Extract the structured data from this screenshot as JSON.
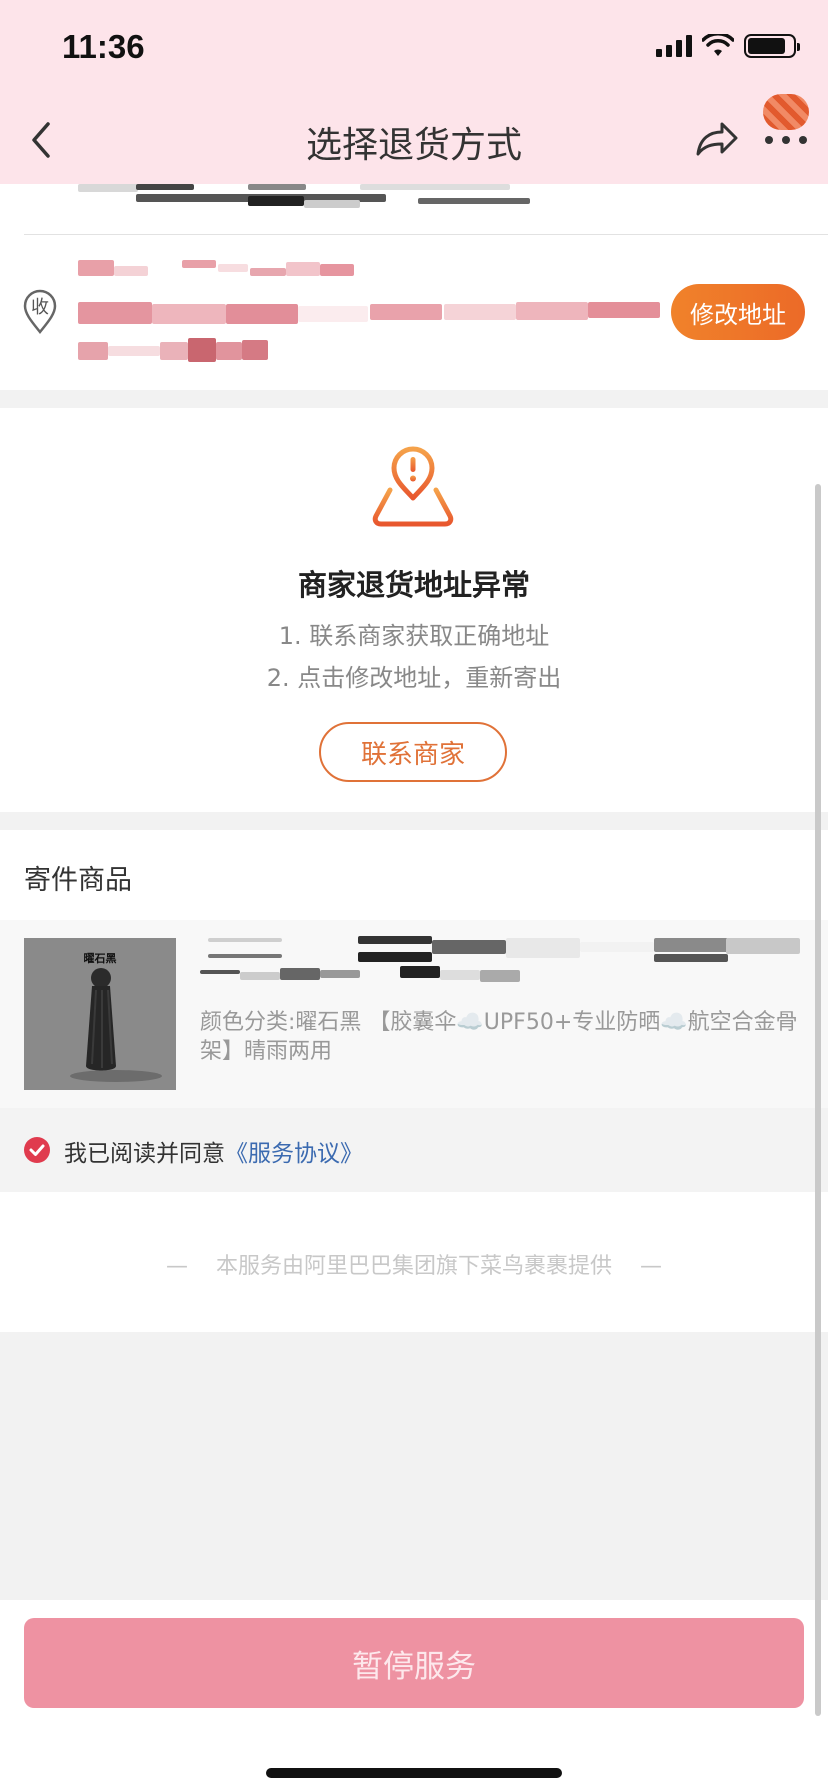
{
  "status_bar": {
    "time": "11:36"
  },
  "nav": {
    "title": "选择退货方式"
  },
  "address": {
    "recv_icon_text": "收",
    "modify_label": "修改地址"
  },
  "warning": {
    "title": "商家退货地址异常",
    "step1": "1. 联系商家获取正确地址",
    "step2": "2. 点击修改地址，重新寄出",
    "contact_label": "联系商家"
  },
  "goods": {
    "header": "寄件商品",
    "thumb_label": "曜石黑",
    "spec": "颜色分类:曜石黑 【胶囊伞☁️UPF50+专业防晒☁️航空合金骨架】晴雨两用"
  },
  "agreement": {
    "text": "我已阅读并同意",
    "link": "《服务协议》"
  },
  "provider": {
    "dash": "—",
    "text": "本服务由阿里巴巴集团旗下菜鸟裹裹提供"
  },
  "bottom": {
    "pause_label": "暂停服务"
  },
  "colors": {
    "header_bg": "#fde4ea",
    "accent_orange": "#ec6a28",
    "check_red": "#e03b4e",
    "link_blue": "#3b6ab0",
    "pause_button": "#ee92a2"
  }
}
